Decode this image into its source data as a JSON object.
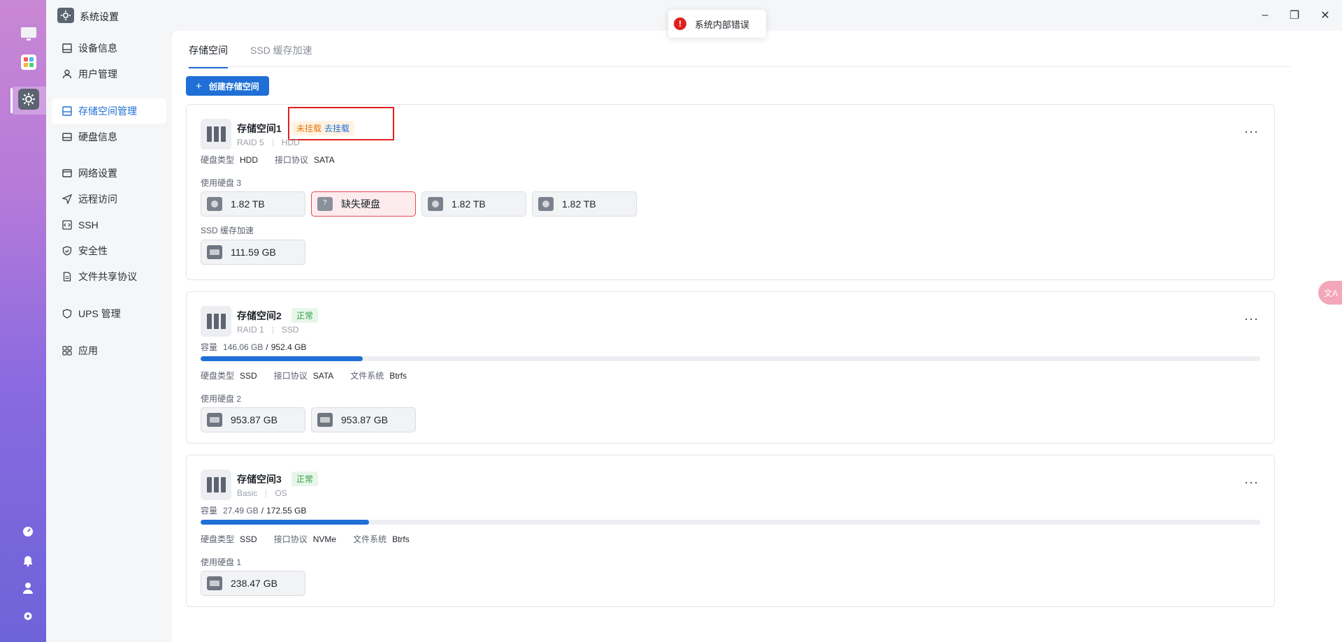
{
  "app": {
    "title": "系统设置"
  },
  "window_controls": {
    "minimize": "–",
    "maximize": "❐",
    "close": "✕"
  },
  "toast": {
    "message": "系统内部错误"
  },
  "sidebar": {
    "items": [
      {
        "label": "设备信息",
        "icon": "device-icon",
        "glyph": "▭"
      },
      {
        "label": "用户管理",
        "icon": "user-icon",
        "glyph": "⚲"
      },
      {
        "label": "存储空间管理",
        "icon": "storage-icon",
        "glyph": "▤",
        "active": true
      },
      {
        "label": "硬盘信息",
        "icon": "disk-icon",
        "glyph": "▭"
      },
      {
        "label": "网络设置",
        "icon": "network-icon",
        "glyph": "▦"
      },
      {
        "label": "远程访问",
        "icon": "send-icon",
        "glyph": "➤"
      },
      {
        "label": "SSH",
        "icon": "code-icon",
        "glyph": "</>"
      },
      {
        "label": "安全性",
        "icon": "shield-icon",
        "glyph": "⛉"
      },
      {
        "label": "文件共享协议",
        "icon": "file-icon",
        "glyph": "▯"
      },
      {
        "label": "UPS 管理",
        "icon": "ups-shield-icon",
        "glyph": "⛉"
      },
      {
        "label": "应用",
        "icon": "apps-grid-icon",
        "glyph": "▦"
      }
    ]
  },
  "tabs": [
    {
      "label": "存储空间",
      "active": true
    },
    {
      "label": "SSD 缓存加速",
      "active": false
    }
  ],
  "create_button": {
    "label": "创建存储空间",
    "icon": "plus-icon"
  },
  "labels": {
    "disk_type": "硬盘类型",
    "interface": "接口协议",
    "filesystem": "文件系统",
    "capacity": "容量",
    "ssd_cache": "SSD 缓存加速"
  },
  "pools": [
    {
      "name": "存储空间1",
      "raid": "RAID 5",
      "media": "HDD",
      "status_warn": "未挂载",
      "status_link": "去挂载",
      "disk_type": "HDD",
      "interface": "SATA",
      "used_disks_label": "使用硬盘 3",
      "disks": [
        {
          "label": "1.82 TB",
          "kind": "hdd"
        },
        {
          "label": "缺失硬盘",
          "kind": "missing"
        },
        {
          "label": "1.82 TB",
          "kind": "hdd"
        },
        {
          "label": "1.82 TB",
          "kind": "hdd"
        }
      ],
      "cache_disk": "111.59 GB"
    },
    {
      "name": "存储空间2",
      "raid": "RAID 1",
      "media": "SSD",
      "status": "正常",
      "capacity_used": "146.06 GB",
      "capacity_total": "952.4 GB",
      "usage_fraction": 0.153,
      "disk_type": "SSD",
      "interface": "SATA",
      "filesystem": "Btrfs",
      "used_disks_label": "使用硬盘 2",
      "disks": [
        {
          "label": "953.87 GB",
          "kind": "ssd"
        },
        {
          "label": "953.87 GB",
          "kind": "ssd"
        }
      ]
    },
    {
      "name": "存储空间3",
      "raid": "Basic",
      "media": "OS",
      "status": "正常",
      "capacity_used": "27.49 GB",
      "capacity_total": "172.55 GB",
      "usage_fraction": 0.159,
      "disk_type": "SSD",
      "interface": "NVMe",
      "filesystem": "Btrfs",
      "used_disks_label": "使用硬盘 1",
      "disks": [
        {
          "label": "238.47 GB",
          "kind": "ssd"
        }
      ]
    }
  ],
  "more_glyph": "···",
  "float_button": {
    "label": "文A"
  },
  "colors": {
    "accent": "#1f6fd6",
    "ok": "#2f9e44",
    "warn": "#e8770f",
    "error": "#e02020"
  }
}
